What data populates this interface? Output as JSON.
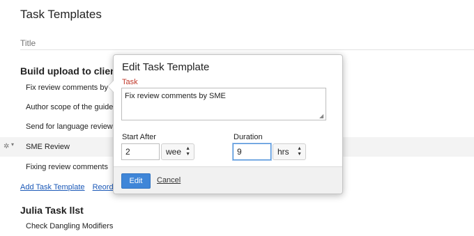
{
  "page": {
    "title": "Task Templates"
  },
  "title_input": {
    "placeholder": "Title"
  },
  "sections": [
    {
      "title": "Build upload to client",
      "tasks": [
        "Fix review comments by S",
        "Author scope of the guide",
        "Send for language review",
        "SME Review",
        "Fixing review comments"
      ]
    },
    {
      "title": "Julia Task llst",
      "tasks": [
        "Check Dangling Modifiers"
      ]
    }
  ],
  "links": {
    "add_task_template": "Add Task Template",
    "reorder": "Reorder"
  },
  "popup": {
    "title": "Edit Task Template",
    "task_label": "Task",
    "task_value": "Fix review comments by SME",
    "start_after_label": "Start After",
    "start_after_value": "2",
    "start_after_unit": "wee",
    "duration_label": "Duration",
    "duration_value": "9",
    "duration_unit": "hrs",
    "edit_label": "Edit",
    "cancel_label": "Cancel"
  },
  "colors": {
    "accent": "#3f86d8",
    "link": "#1a58b7",
    "required_label": "#c0392b"
  },
  "icons": {
    "row_settings": "gear-icon",
    "row_menu": "caret-down-icon",
    "select_arrows": "up-down-arrows-icon"
  }
}
